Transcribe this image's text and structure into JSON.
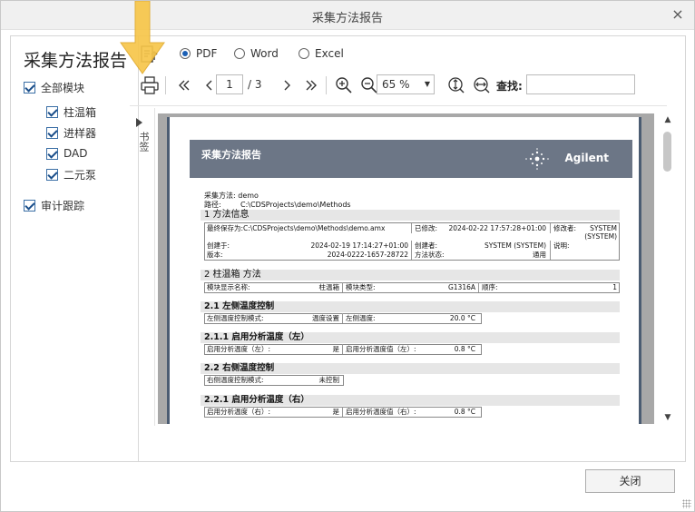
{
  "window": {
    "title": "采集方法报告",
    "close_glyph": "×"
  },
  "left_panel": {
    "heading": "采集方法报告",
    "all_modules": "全部模块",
    "modules": [
      "柱温箱",
      "进样器",
      "DAD",
      "二元泵"
    ],
    "audit_trail": "审计跟踪"
  },
  "toolbar": {
    "export_icon": "export-icon",
    "formats": [
      "PDF",
      "Word",
      "Excel"
    ],
    "selected_format": "PDF",
    "page_current": "1",
    "page_total": "/ 3",
    "zoom_level": "65 %",
    "find_label": "查找:",
    "find_value": ""
  },
  "outline": {
    "label": "书签"
  },
  "report": {
    "title": "采集方法报告",
    "brand": "Agilent",
    "method_line": "采集方法:  demo",
    "path_label": "路径:",
    "path_value": "C:\\CDSProjects\\demo\\Methods",
    "sec1": "1  方法信息",
    "r1": {
      "saved_label": "最终保存为:",
      "saved_value": "C:\\CDSProjects\\demo\\Methods\\demo.amx",
      "modified_label": "已修改:",
      "modified_value": "2024-02-22 17:57:28+01:00",
      "modifier_label": "修改者:",
      "modifier_value": "SYSTEM",
      "modifier_value2": "(SYSTEM)"
    },
    "r2": {
      "created_label": "创建于:",
      "created_value": "2024-02-19 17:14:27+01:00",
      "creator_label": "创建者:",
      "creator_value": "SYSTEM (SYSTEM)",
      "desc_label": "说明:"
    },
    "r3": {
      "version_label": "版本:",
      "version_value": "2024-0222-1657-28722",
      "status_label": "方法状态:",
      "status_value": "通用"
    },
    "sec2": "2  柱温箱 方法",
    "r4": {
      "name_label": "模块显示名称:",
      "name_value": "柱温箱",
      "type_label": "模块类型:",
      "type_value": "G1316A",
      "order_label": "顺序:",
      "order_value": "1"
    },
    "sec21": "2.1  左侧温度控制",
    "r5": {
      "mode_label": "左侧温度控制模式:",
      "mode_value": "温度设置",
      "temp_label": "左侧温度:",
      "temp_value": "20.0 °C"
    },
    "sec211": "2.1.1  启用分析温度（左）",
    "r6": {
      "enable_label": "启用分析温度（左）:",
      "enable_value": "是",
      "val_label": "启用分析温度值（左）:",
      "val_value": "0.8 °C"
    },
    "sec22": "2.2  右侧温度控制",
    "r7": {
      "mode_label": "右侧温度控制模式:",
      "mode_value": "未控制"
    },
    "sec221": "2.2.1  启用分析温度（右）",
    "r8": {
      "enable_label": "启用分析温度（右）:",
      "enable_value": "是",
      "val_label": "启用分析温度值（右）:",
      "val_value": "0.8 °C"
    }
  },
  "footer": {
    "close_label": "关闭"
  },
  "colors": {
    "accent": "#1a5fb4",
    "banner": "#6c7686",
    "arrow": "#f7c64a"
  }
}
